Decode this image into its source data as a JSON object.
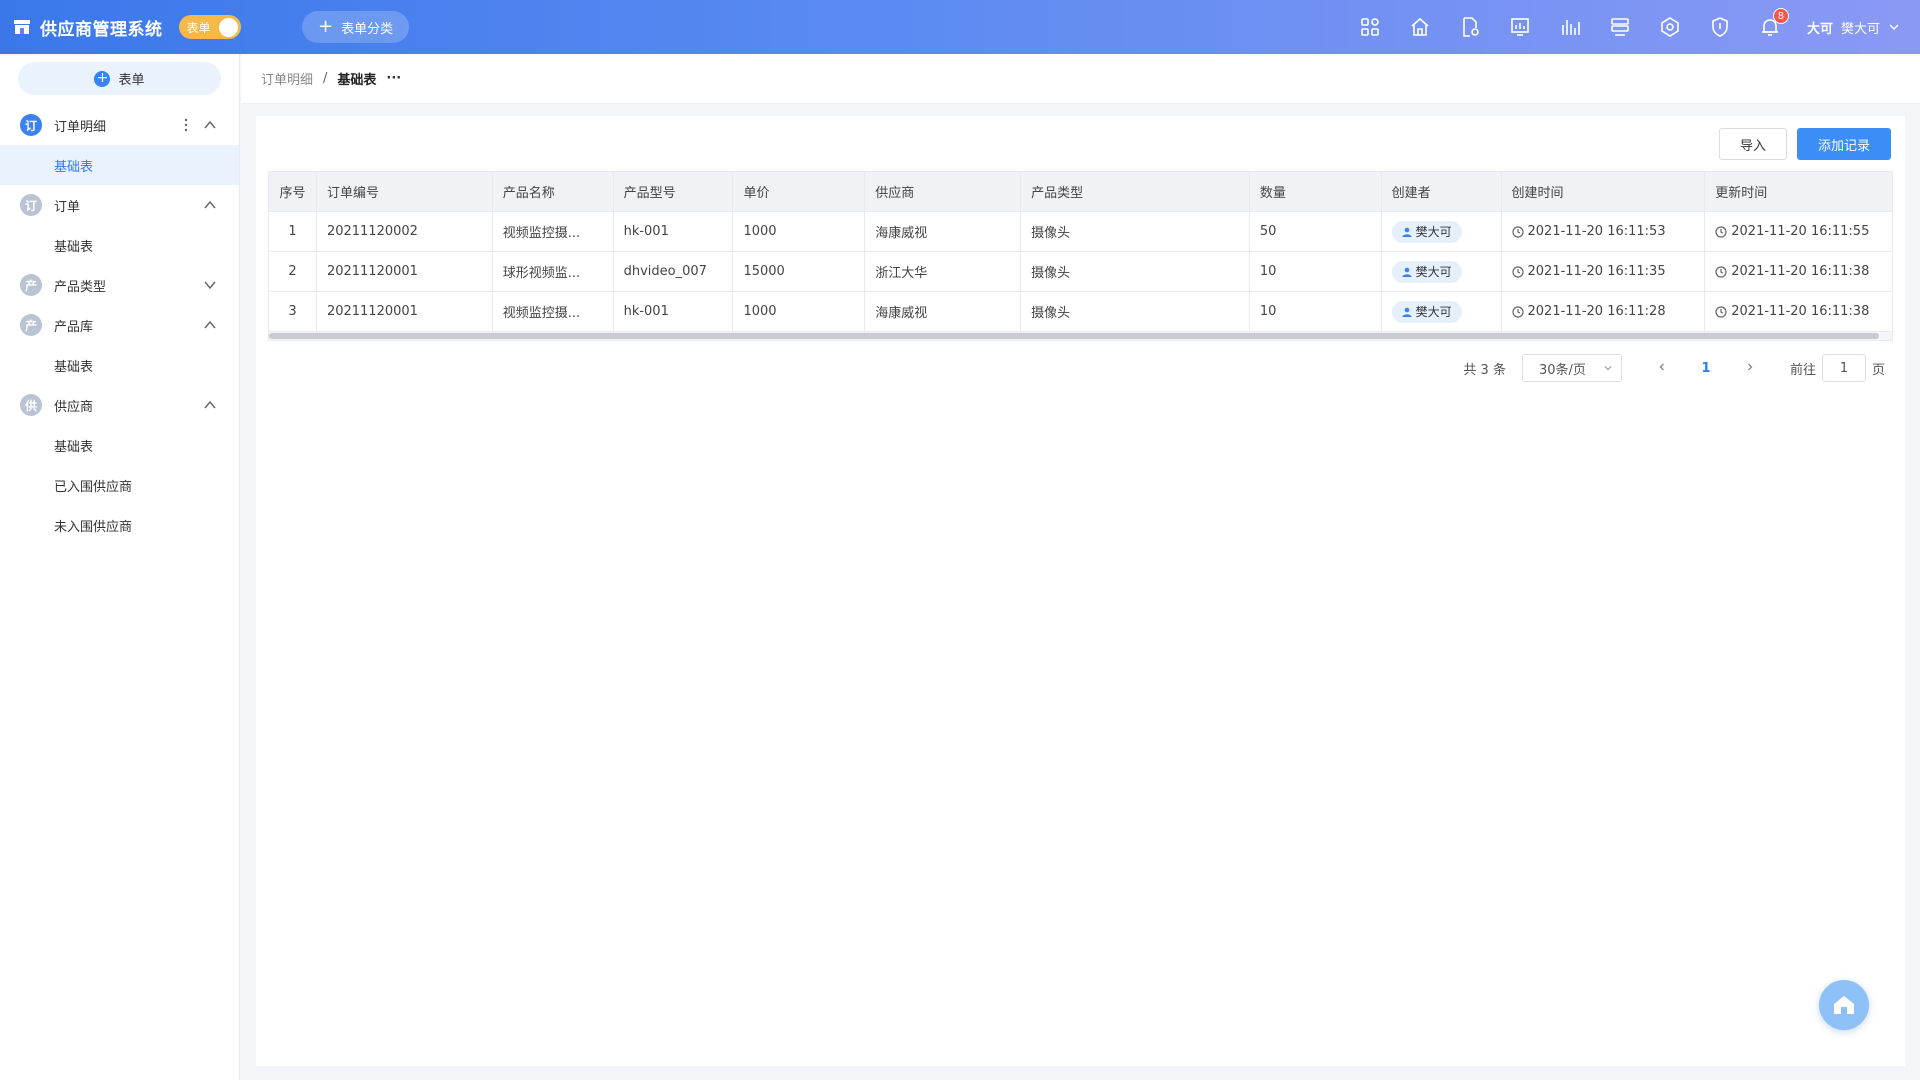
{
  "header": {
    "app_title": "供应商管理系统",
    "mode_toggle_label": "表单",
    "add_category_label": "表单分类",
    "notification_count": "8",
    "avatar_text": "大可",
    "user_name": "樊大可",
    "icons": [
      "apps-icon",
      "home-icon",
      "document-settings-icon",
      "dashboard-icon",
      "chart-icon",
      "server-icon",
      "network-icon",
      "shield-icon",
      "bell-icon"
    ]
  },
  "sidebar": {
    "new_form_label": "表单",
    "groups": [
      {
        "icon_char": "订",
        "label": "订单明细",
        "expanded": true,
        "subs": [
          "基础表"
        ]
      },
      {
        "icon_char": "订",
        "label": "订单",
        "expanded": true,
        "subs": [
          "基础表"
        ]
      },
      {
        "icon_char": "产",
        "label": "产品类型",
        "expanded": false,
        "subs": []
      },
      {
        "icon_char": "产",
        "label": "产品库",
        "expanded": true,
        "subs": [
          "基础表"
        ]
      },
      {
        "icon_char": "供",
        "label": "供应商",
        "expanded": true,
        "subs": [
          "基础表",
          "已入围供应商",
          "未入围供应商"
        ]
      }
    ]
  },
  "breadcrumb": {
    "parent": "订单明细",
    "separator": "/",
    "current": "基础表",
    "more": "···"
  },
  "toolbar": {
    "import_label": "导入",
    "add_label": "添加记录"
  },
  "table": {
    "columns": [
      "序号",
      "订单编号",
      "产品名称",
      "产品型号",
      "单价",
      "供应商",
      "产品类型",
      "数量",
      "创建者",
      "创建时间",
      "更新时间"
    ],
    "rows": [
      [
        "1",
        "20211120002",
        "视频监控摄...",
        "hk-001",
        "1000",
        "海康威视",
        "摄像头",
        "50",
        "樊大可",
        "2021-11-20 16:11:53",
        "2021-11-20 16:11:55"
      ],
      [
        "2",
        "20211120001",
        "球形视频监...",
        "dhvideo_007",
        "15000",
        "浙江大华",
        "摄像头",
        "10",
        "樊大可",
        "2021-11-20 16:11:35",
        "2021-11-20 16:11:38"
      ],
      [
        "3",
        "20211120001",
        "视频监控摄...",
        "hk-001",
        "1000",
        "海康威视",
        "摄像头",
        "10",
        "樊大可",
        "2021-11-20 16:11:28",
        "2021-11-20 16:11:38"
      ]
    ]
  },
  "pagination": {
    "total_text": "共 3 条",
    "page_size": "30条/页",
    "current_page": "1",
    "goto_prefix": "前往",
    "goto_value": "1",
    "goto_suffix": "页"
  },
  "colors": {
    "primary": "#3a8ef6",
    "header_gradient_start": "#3a78ea",
    "header_gradient_end": "#8a99f4",
    "toggle": "#f5b94a",
    "badge": "#f5564a"
  }
}
